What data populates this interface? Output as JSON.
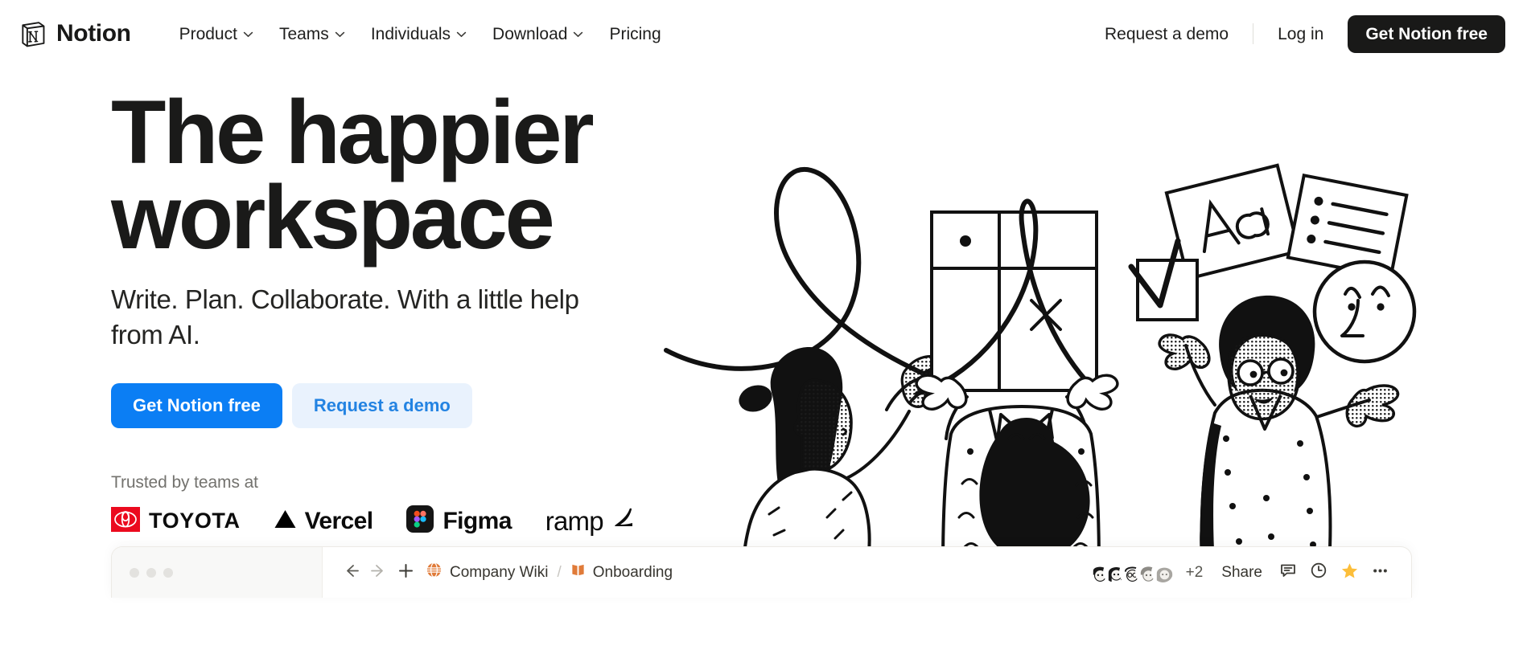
{
  "brand": {
    "name": "Notion",
    "logo_icon": "notion-book-icon"
  },
  "nav": {
    "links": [
      {
        "label": "Product",
        "has_dropdown": true
      },
      {
        "label": "Teams",
        "has_dropdown": true
      },
      {
        "label": "Individuals",
        "has_dropdown": true
      },
      {
        "label": "Download",
        "has_dropdown": true
      },
      {
        "label": "Pricing",
        "has_dropdown": false
      }
    ],
    "request_demo": "Request a demo",
    "log_in": "Log in",
    "get_free": "Get Notion free"
  },
  "hero": {
    "headline_line1": "The happier",
    "headline_line2": "workspace",
    "subhead": "Write. Plan. Collaborate. With a little help from AI.",
    "primary_cta": "Get Notion free",
    "secondary_cta": "Request a demo",
    "trusted_label": "Trusted by teams at",
    "logos": [
      {
        "name": "Toyota",
        "text": "TOYOTA",
        "mark_color": "#EB0A1E"
      },
      {
        "name": "Vercel",
        "text": "Vercel",
        "mark_color": "#000000"
      },
      {
        "name": "Figma",
        "text": "Figma",
        "mark_color": "#151515"
      },
      {
        "name": "ramp",
        "text": "ramp",
        "mark_color": "#0C0C0C"
      }
    ]
  },
  "browser_mock": {
    "back_icon": "arrow-left-icon",
    "forward_icon": "arrow-right-icon",
    "new_page_icon": "plus-icon",
    "workspace_icon": "globe-icon",
    "workspace_name": "Company Wiki",
    "separator": "/",
    "page_icon": "open-book-icon",
    "page_name": "Onboarding",
    "overflow_members": "+2",
    "share_label": "Share",
    "comment_icon": "comment-icon",
    "history_icon": "clock-icon",
    "favorite_icon": "star-icon",
    "more_icon": "ellipsis-icon",
    "avatar_count": 5
  },
  "colors": {
    "brand_black": "#191918",
    "accent_blue": "#0B7EF4",
    "accent_blue_soft_bg": "#E9F2FD",
    "accent_blue_soft_text": "#2383E2",
    "muted_text": "#73726E",
    "star_yellow": "#FCBE3A",
    "notion_orange": "#E07B39"
  }
}
